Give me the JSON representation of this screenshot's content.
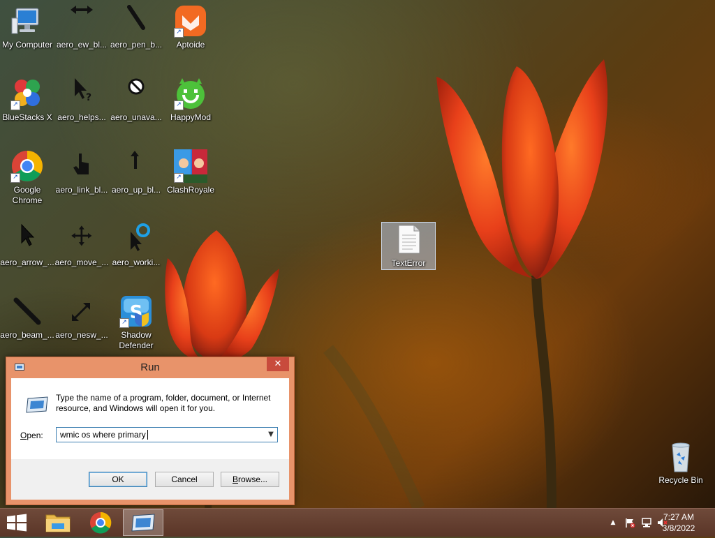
{
  "desktop": {
    "icons": [
      {
        "label": "My Computer"
      },
      {
        "label": "aero_ew_bl..."
      },
      {
        "label": "aero_pen_b..."
      },
      {
        "label": "Aptoide"
      },
      {
        "label": "BlueStacks X"
      },
      {
        "label": "aero_helps..."
      },
      {
        "label": "aero_unava..."
      },
      {
        "label": "HappyMod"
      },
      {
        "label": "Google Chrome"
      },
      {
        "label": "aero_link_bl..."
      },
      {
        "label": "aero_up_bl..."
      },
      {
        "label": "ClashRoyale"
      },
      {
        "label": "aero_arrow_..."
      },
      {
        "label": "aero_move_..."
      },
      {
        "label": "aero_worki..."
      },
      {
        "label": "aero_beam_..."
      },
      {
        "label": "aero_nesw_..."
      },
      {
        "label": "Shadow Defender"
      },
      {
        "label": "TextError"
      },
      {
        "label": "Recycle Bin"
      }
    ]
  },
  "run_dialog": {
    "title": "Run",
    "description": "Type the name of a program, folder, document, or Internet resource, and Windows will open it for you.",
    "open_label_prefix": "",
    "open_label_underlined": "O",
    "open_label_rest": "pen:",
    "open_value": "wmic os where primary",
    "ok_label": "OK",
    "cancel_label": "Cancel",
    "browse_label_prefix": "",
    "browse_label_underlined": "B",
    "browse_label_rest": "rowse...",
    "close_glyph": "✕"
  },
  "taskbar": {
    "clock_time": "7:27 AM",
    "clock_date": "3/8/2022",
    "tray_expand_glyph": "▲",
    "accent": "#6a4334"
  }
}
